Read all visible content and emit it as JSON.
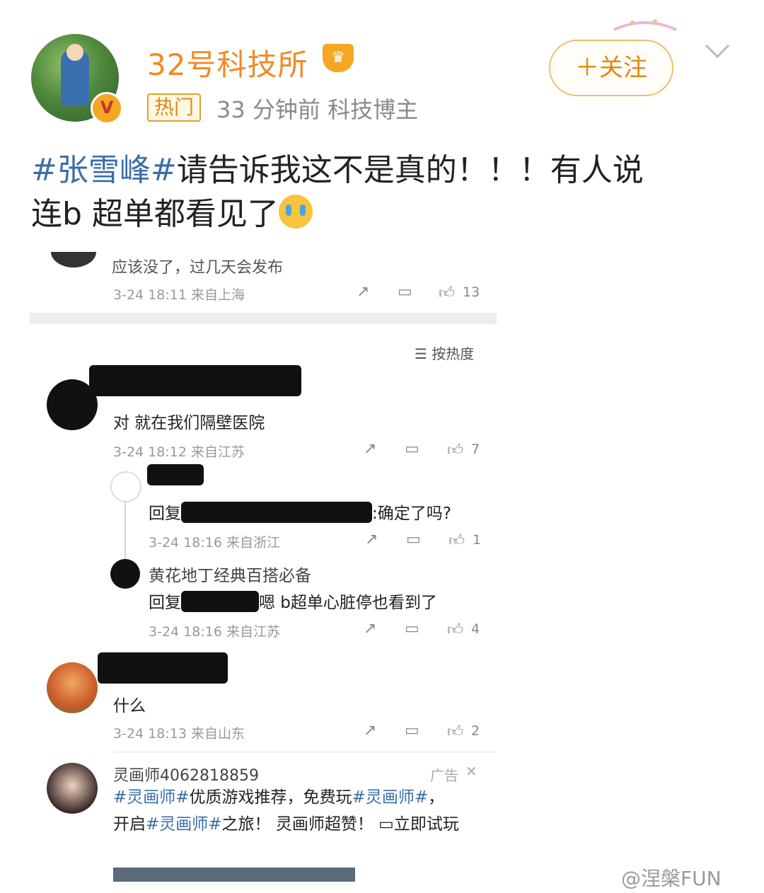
{
  "header": {
    "username": "32号科技所",
    "hot_tag": "热门",
    "meta": "33 分钟前  科技博主",
    "follow_label": "＋关注",
    "verified_label": "V"
  },
  "post": {
    "hashtag": "#张雪峰#",
    "text_line1": "请告诉我这不是真的！！！有人说",
    "text_line2": "连b 超单都看见了"
  },
  "screenshot": {
    "top_comment": {
      "text": "应该没了，过几天会发布",
      "time": "3-24 18:11 来自上海",
      "likes": "13"
    },
    "sort_label": "按热度",
    "comments": [
      {
        "text": "对 就在我们隔壁医院",
        "time": "3-24 18:12 来自江苏",
        "likes": "7"
      },
      {
        "prefix": "回复",
        "suffix": ":确定了吗?",
        "time": "3-24 18:16 来自浙江",
        "likes": "1"
      },
      {
        "name": "黄花地丁经典百搭必备",
        "prefix": "回复",
        "suffix": "嗯 b超单心脏停也看到了",
        "time": "3-24 18:16 来自江苏",
        "likes": "4"
      },
      {
        "text": "什么",
        "time": "3-24 18:13 来自山东",
        "likes": "2"
      }
    ],
    "ad": {
      "name": "灵画师4062818859",
      "label": "广告",
      "tag1": "#灵画师#",
      "t1": "优质游戏推荐，免费玩",
      "tag2": "#灵画师#",
      "t2": "，",
      "t3": "开启",
      "tag3": "#灵画师#",
      "t4": "之旅！ 灵画师超赞！",
      "cta": "立即试玩"
    }
  },
  "watermark": "@涅槃FUN",
  "colors": {
    "accent": "#f08a24",
    "link": "#3b6ea8",
    "muted": "#999999"
  },
  "icons": [
    "share-icon",
    "comment-icon",
    "like-icon",
    "close-icon",
    "chevron-down-icon",
    "crown-icon"
  ]
}
